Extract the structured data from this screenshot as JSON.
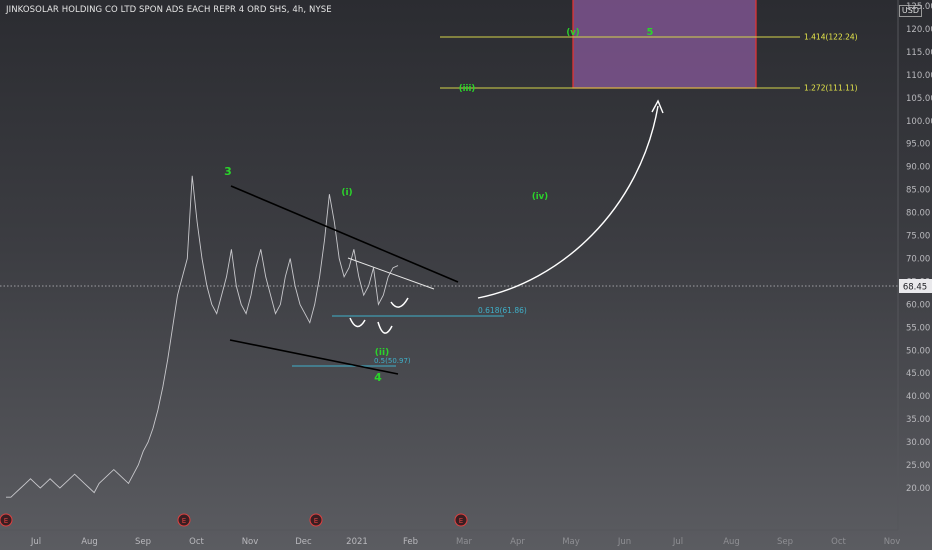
{
  "header": {
    "title": "JINKOSOLAR HOLDING CO LTD SPON ADS EACH REPR 4 ORD SHS, 4h, NYSE",
    "currency": "USD"
  },
  "price_axis": {
    "ticks": [
      "125.00",
      "120.00",
      "115.00",
      "110.00",
      "105.00",
      "100.00",
      "95.00",
      "90.00",
      "85.00",
      "80.00",
      "75.00",
      "70.00",
      "65.00",
      "60.00",
      "55.00",
      "50.00",
      "45.00",
      "40.00",
      "35.00",
      "30.00",
      "25.00",
      "20.00"
    ],
    "current_price": "68.45"
  },
  "time_axis": {
    "labels": [
      "Jul",
      "Aug",
      "Sep",
      "Oct",
      "Nov",
      "Dec",
      "2021",
      "Feb",
      "Mar",
      "Apr",
      "May",
      "Jun",
      "Jul",
      "Aug",
      "Sep",
      "Oct",
      "Nov"
    ]
  },
  "earnings_markers": [
    "E",
    "E",
    "E",
    "E"
  ],
  "wave_labels": {
    "w3": "3",
    "w4": "4",
    "wi": "(i)",
    "wii": "(ii)",
    "wiii": "(iii)",
    "wiv": "(iv)",
    "wv": "(v)",
    "w5": "5"
  },
  "fib_levels": {
    "f1414": "1.414(122.24)",
    "f1272": "1.272(111.11)",
    "f0618": "0.618(61.86)",
    "f05": "0.5(50.97)"
  },
  "colors": {
    "candles": "#c8c8cc",
    "wave_label": "#2bd42b",
    "fib_line": "#d4d44a",
    "fib_text": "#e8e84a",
    "teal_line": "#3fb0c9",
    "target_box_fill": "#8a5a9e",
    "target_box_border": "#e03333",
    "trendline": "#000000",
    "arrow": "#ffffff",
    "earnings": "#e04040"
  },
  "chart_data": {
    "type": "line",
    "series": [
      {
        "values": [
          18,
          18,
          19,
          20,
          21,
          22,
          21,
          20,
          21,
          22,
          21,
          20,
          21,
          22,
          23,
          22,
          21,
          20,
          19,
          21,
          22,
          23,
          24,
          23,
          22,
          21,
          23,
          25,
          28,
          30,
          33,
          37,
          42,
          48,
          55,
          62,
          66,
          70,
          88,
          78,
          70,
          64,
          60,
          58,
          62,
          66,
          72,
          64,
          60,
          58,
          62,
          68,
          72,
          66,
          62,
          58,
          60,
          66,
          70,
          64,
          60,
          58,
          56,
          60,
          66,
          74,
          84,
          78,
          70,
          66,
          68,
          72,
          66,
          62,
          64,
          68,
          60,
          62,
          66,
          68,
          68.45
        ]
      }
    ],
    "ylim": [
      17,
      128
    ],
    "trend_lines": [
      {
        "from": [
          "Oct",
          89
        ],
        "to": [
          "Dec",
          71
        ]
      },
      {
        "from": [
          "Oct",
          58
        ],
        "to": [
          "Dec",
          50
        ]
      }
    ],
    "fib_levels": [
      122.24,
      111.11,
      61.86,
      50.97
    ],
    "target_zone": [
      111.11,
      128
    ]
  }
}
